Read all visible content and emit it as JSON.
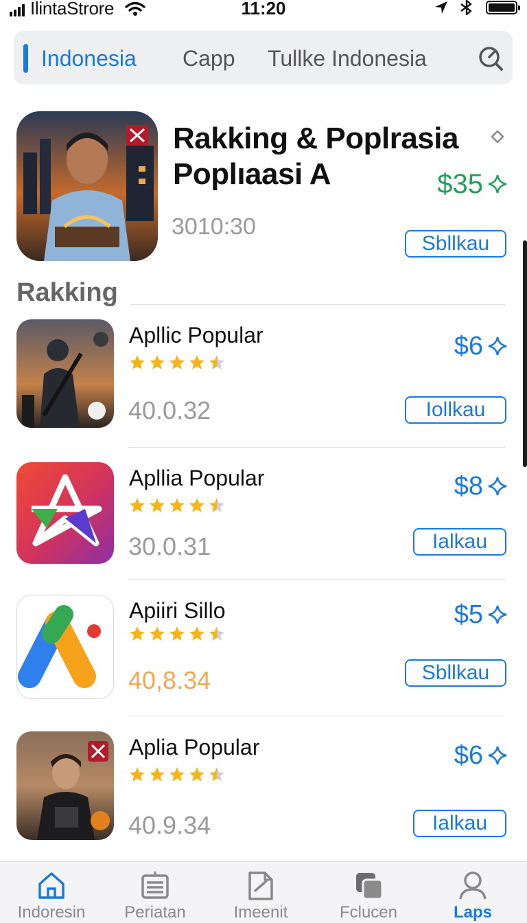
{
  "status_bar": {
    "carrier": "IlintaStrore",
    "time": "11:20"
  },
  "segmented": {
    "tabs": [
      {
        "label": "Indonesia",
        "active": true
      },
      {
        "label": "Capp",
        "active": false
      },
      {
        "label": "Tullke Indonesia",
        "active": false
      }
    ],
    "search_icon": "search-icon"
  },
  "featured": {
    "title": "Rakking & Poplrasia Poplıaasi A",
    "price": "$35",
    "version": "3010:30",
    "button_label": "Sbllkau",
    "price_color": "#23a05a"
  },
  "section": {
    "title": "Rakking"
  },
  "apps": [
    {
      "name": "Apllic Popular",
      "rating": 4.5,
      "version": "40.0.32",
      "price": "$6",
      "button_label": "Iollkau"
    },
    {
      "name": "Apllia Popular",
      "rating": 4.5,
      "version": "30.0.31",
      "price": "$8",
      "button_label": "Ialkau"
    },
    {
      "name": "Apiiri Sillo",
      "rating": 4.5,
      "version": "40,8.34",
      "price": "$5",
      "button_label": "Sbllkau"
    },
    {
      "name": "Aplia Popular",
      "rating": 4.5,
      "version": "40.9.34",
      "price": "$6",
      "button_label": "Ialkau"
    }
  ],
  "tab_bar": {
    "items": [
      {
        "label": "Indoresin",
        "icon": "home-icon",
        "active": false
      },
      {
        "label": "Periatan",
        "icon": "list-icon",
        "active": false
      },
      {
        "label": "Imeenit",
        "icon": "document-icon",
        "active": false
      },
      {
        "label": "Fclucen",
        "icon": "stack-icon",
        "active": false
      },
      {
        "label": "Laps",
        "icon": "person-icon",
        "active": true
      }
    ]
  },
  "colors": {
    "accent": "#1a7ad9",
    "star": "#f5b417",
    "featured_price": "#23a05a"
  }
}
